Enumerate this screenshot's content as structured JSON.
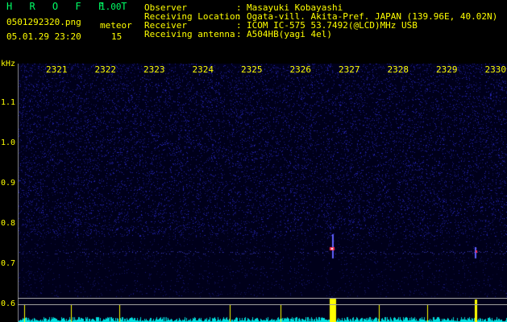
{
  "app": {
    "name": "H R O F F T",
    "version": "1.00"
  },
  "meta": {
    "filename": "0501292320.png",
    "datetime": "05.01.29 23:20",
    "meteor_label": "meteor",
    "meteor_count": "15"
  },
  "info": [
    {
      "label": "Observer",
      "value": "Masayuki Kobayashi"
    },
    {
      "label": "Receiving Location",
      "value": "Ogata-vill. Akita-Pref. JAPAN (139.96E, 40.02N)"
    },
    {
      "label": "Receiver",
      "value": "ICOM IC-575 53.7492(@LCD)MHz USB"
    },
    {
      "label": "Receiving antenna",
      "value": "A504HB(yagi 4el)"
    }
  ],
  "colon": ":",
  "axis": {
    "y_unit": "kHz",
    "x_ticks": [
      "2321",
      "2322",
      "2323",
      "2324",
      "2325",
      "2326",
      "2327",
      "2328",
      "2329",
      "2330"
    ],
    "y_ticks": [
      "1.1",
      "1.0",
      "0.9",
      "0.8",
      "0.7",
      "0.6"
    ]
  },
  "colors": {
    "text": "#ffff00",
    "title": "#00ff66",
    "noise": "#1a1aa0",
    "echo": "#ff3050",
    "level": "#ffff00",
    "noise_level": "#00e0e0"
  }
}
